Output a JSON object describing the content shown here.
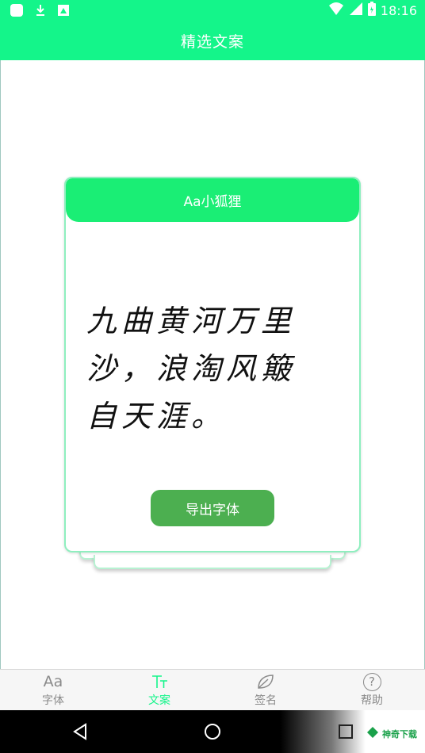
{
  "status_bar": {
    "time": "18:16",
    "left_icons": [
      "app-icon",
      "download-icon",
      "image-icon"
    ],
    "right_icons": [
      "wifi-icon",
      "signal-icon",
      "battery-icon"
    ]
  },
  "header": {
    "title": "精选文案"
  },
  "card": {
    "font_name": "Aa小狐狸",
    "sample_text": "九曲黄河万里沙，浪淘风簸自天涯。",
    "export_label": "导出字体"
  },
  "bottom_nav": {
    "items": [
      {
        "label": "字体",
        "icon": "font-aa-icon",
        "active": false
      },
      {
        "label": "文案",
        "icon": "text-tt-icon",
        "active": true
      },
      {
        "label": "签名",
        "icon": "signature-leaf-icon",
        "active": false
      },
      {
        "label": "帮助",
        "icon": "help-question-icon",
        "active": false
      }
    ],
    "aa_glyph": "Aa",
    "help_glyph": "?"
  },
  "system_nav": {
    "buttons": [
      "back-icon",
      "home-icon",
      "recents-icon"
    ],
    "watermark_text": "神奇下载"
  },
  "colors": {
    "accent": "#14f58a",
    "card_header": "#1aee75",
    "export_button": "#4caf50",
    "nav_inactive": "#8a8a8a"
  }
}
